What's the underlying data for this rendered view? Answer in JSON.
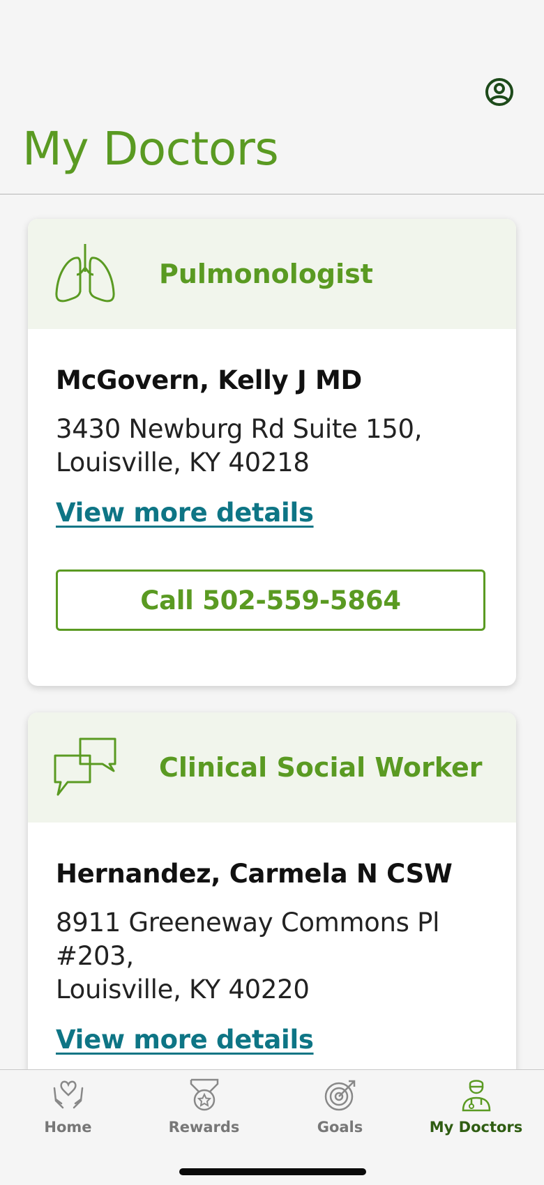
{
  "header": {
    "title": "My Doctors",
    "profile_icon": "profile-icon"
  },
  "doctors": [
    {
      "specialty": "Pulmonologist",
      "icon": "lungs-icon",
      "name": "McGovern, Kelly J MD",
      "address_line1": "3430 Newburg Rd Suite 150,",
      "address_line2": "Louisville, KY 40218",
      "link_label": "View more details",
      "call_label": "Call 502-559-5864"
    },
    {
      "specialty": "Clinical Social Worker",
      "icon": "chat-bubbles-icon",
      "name": "Hernandez, Carmela N CSW",
      "address_line1": "8911 Greeneway Commons Pl #203,",
      "address_line2": "Louisville, KY 40220",
      "link_label": "View more details"
    }
  ],
  "tabbar": {
    "tabs": [
      {
        "label": "Home",
        "icon": "hands-heart-icon",
        "active": false
      },
      {
        "label": "Rewards",
        "icon": "medal-icon",
        "active": false
      },
      {
        "label": "Goals",
        "icon": "target-icon",
        "active": false
      },
      {
        "label": "My Doctors",
        "icon": "doctor-icon",
        "active": true
      }
    ]
  },
  "colors": {
    "brand_green": "#5a9a22",
    "dark_green": "#2f5d12",
    "link_teal": "#0e7585",
    "card_head_bg": "#f1f5ec"
  }
}
